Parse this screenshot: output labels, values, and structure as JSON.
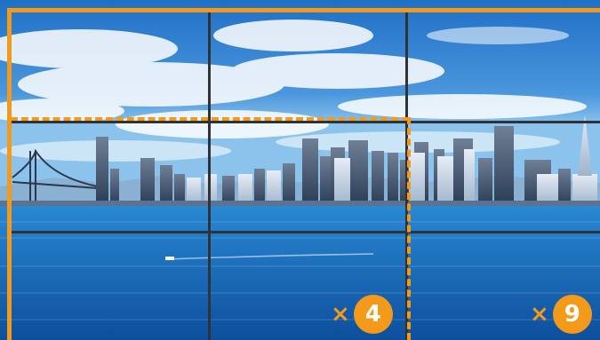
{
  "scene": {
    "description_icon": "city-skyline-over-water-image",
    "accent_color": "#f39a1b",
    "grid_line_color": "#2f3338"
  },
  "badges": {
    "left": {
      "symbol": "×",
      "value": "4"
    },
    "right": {
      "symbol": "×",
      "value": "9"
    }
  }
}
